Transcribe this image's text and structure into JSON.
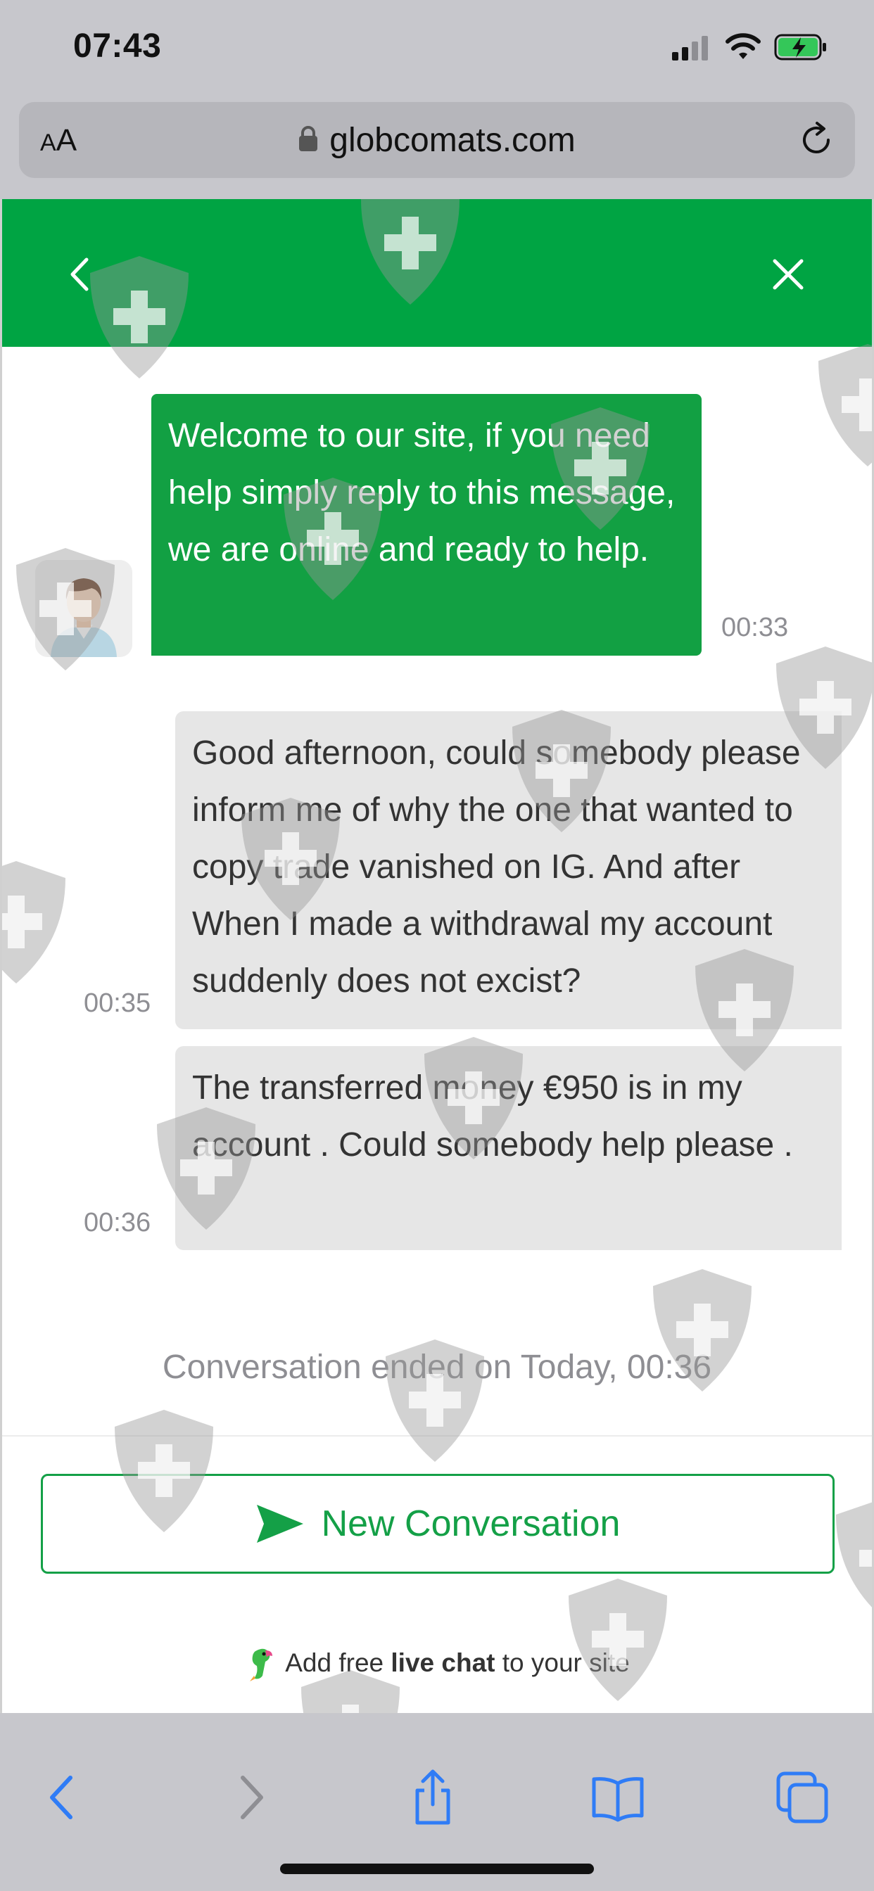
{
  "status_bar": {
    "time": "07:43"
  },
  "browser": {
    "text_size_button": "AA",
    "url": "globcomats.com"
  },
  "chat": {
    "messages": [
      {
        "sender": "agent",
        "text": "Welcome to our site, if you need help simply reply to this message, we are online and ready to help.",
        "time": "00:33"
      },
      {
        "sender": "user",
        "text": "Good afternoon, could somebody please inform me of why the one that wanted to copy trade vanished on IG. And after When I made a withdrawal my account suddenly does not excist?",
        "time": "00:35"
      },
      {
        "sender": "user",
        "text": "The transferred money €950 is in my account . Could somebody help please .",
        "time": "00:36"
      }
    ],
    "ended_notice": "Conversation ended on Today, 00:36",
    "new_conversation_label": "New Conversation",
    "footer": {
      "prefix": "Add free ",
      "bold": "live chat",
      "suffix": " to your site"
    }
  },
  "icons": {
    "header_back": "chevron-left-icon",
    "header_close": "close-icon",
    "send": "send-icon",
    "reload": "reload-icon",
    "lock": "lock-icon"
  },
  "colors": {
    "brand_green": "#00a443",
    "agent_bubble": "#12a043",
    "user_bubble": "#e6e6e6",
    "ios_blue": "#2f7cf6",
    "chrome_gray": "#c7c7cc"
  }
}
